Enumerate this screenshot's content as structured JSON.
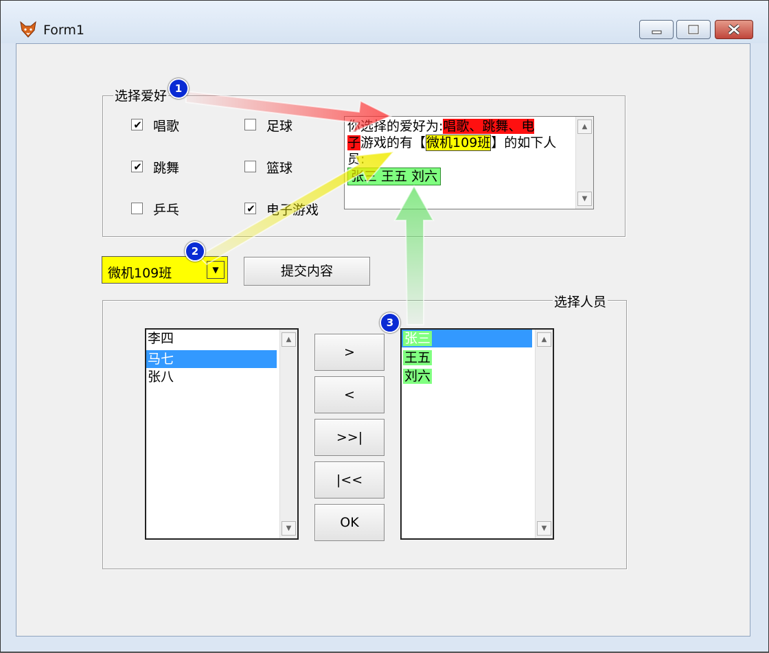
{
  "window": {
    "title": "Form1"
  },
  "hobbies": {
    "legend": "选择爱好",
    "checkboxes": [
      {
        "label": "唱歌",
        "checked": "✔"
      },
      {
        "label": "跳舞",
        "checked": "✔"
      },
      {
        "label": "乒乓",
        "checked": ""
      },
      {
        "label": "足球",
        "checked": ""
      },
      {
        "label": "篮球",
        "checked": ""
      },
      {
        "label": "电子游戏",
        "checked": "✔"
      }
    ]
  },
  "result": {
    "line1_prefix": "你选择的爱好为:",
    "hobbies_text": "唱歌、跳舞、电",
    "hobbies_text_cont": "子",
    "middle": "游戏的有【",
    "class_name": "微机109班",
    "suffix": "】的如下人员:",
    "people_text": "张三 王五 刘六"
  },
  "combo": {
    "value": "微机109班",
    "arrow": "▼"
  },
  "submit_button": "提交内容",
  "people": {
    "legend": "选择人员",
    "available": [
      "李四",
      "马七",
      "张八"
    ],
    "selected": [
      "张三",
      "王五",
      "刘六"
    ],
    "buttons": {
      "add": ">",
      "remove": "<",
      "add_all": ">>|",
      "remove_all": "|<<",
      "ok": "OK"
    }
  },
  "badges": [
    "1",
    "2",
    "3"
  ],
  "colors": {
    "red_highlight": "#ff1010",
    "yellow_highlight": "#ffff00",
    "green_highlight": "#80ff80",
    "selection": "#3399ff",
    "badge": "#0a2bd4"
  }
}
